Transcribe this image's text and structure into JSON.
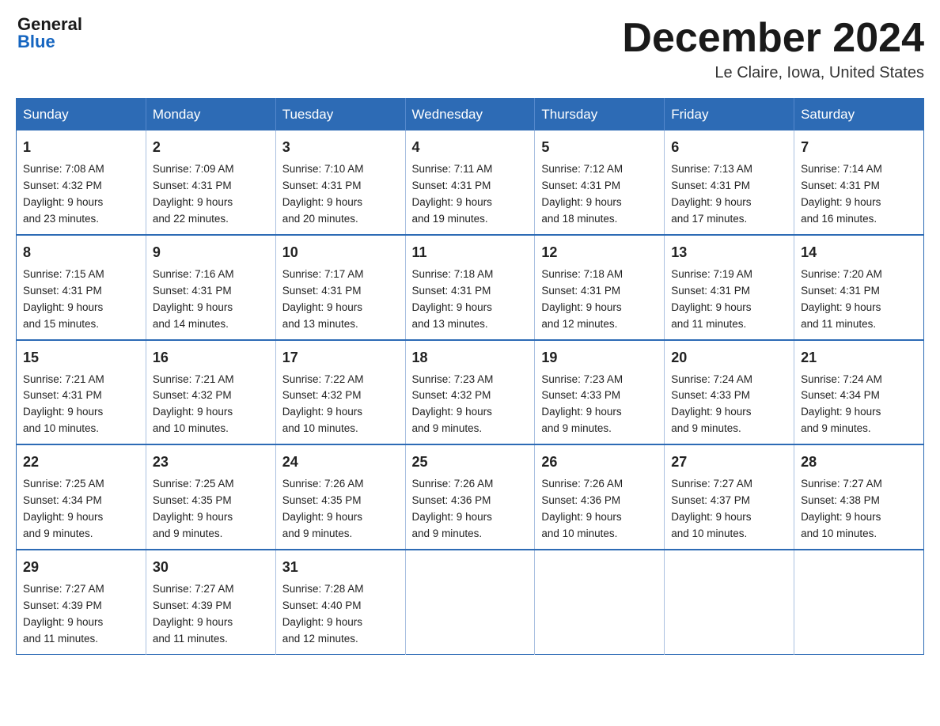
{
  "header": {
    "logo_general": "General",
    "logo_blue": "Blue",
    "month_title": "December 2024",
    "location": "Le Claire, Iowa, United States"
  },
  "days_of_week": [
    "Sunday",
    "Monday",
    "Tuesday",
    "Wednesday",
    "Thursday",
    "Friday",
    "Saturday"
  ],
  "weeks": [
    [
      {
        "num": "1",
        "sunrise": "7:08 AM",
        "sunset": "4:32 PM",
        "daylight": "9 hours and 23 minutes."
      },
      {
        "num": "2",
        "sunrise": "7:09 AM",
        "sunset": "4:31 PM",
        "daylight": "9 hours and 22 minutes."
      },
      {
        "num": "3",
        "sunrise": "7:10 AM",
        "sunset": "4:31 PM",
        "daylight": "9 hours and 20 minutes."
      },
      {
        "num": "4",
        "sunrise": "7:11 AM",
        "sunset": "4:31 PM",
        "daylight": "9 hours and 19 minutes."
      },
      {
        "num": "5",
        "sunrise": "7:12 AM",
        "sunset": "4:31 PM",
        "daylight": "9 hours and 18 minutes."
      },
      {
        "num": "6",
        "sunrise": "7:13 AM",
        "sunset": "4:31 PM",
        "daylight": "9 hours and 17 minutes."
      },
      {
        "num": "7",
        "sunrise": "7:14 AM",
        "sunset": "4:31 PM",
        "daylight": "9 hours and 16 minutes."
      }
    ],
    [
      {
        "num": "8",
        "sunrise": "7:15 AM",
        "sunset": "4:31 PM",
        "daylight": "9 hours and 15 minutes."
      },
      {
        "num": "9",
        "sunrise": "7:16 AM",
        "sunset": "4:31 PM",
        "daylight": "9 hours and 14 minutes."
      },
      {
        "num": "10",
        "sunrise": "7:17 AM",
        "sunset": "4:31 PM",
        "daylight": "9 hours and 13 minutes."
      },
      {
        "num": "11",
        "sunrise": "7:18 AM",
        "sunset": "4:31 PM",
        "daylight": "9 hours and 13 minutes."
      },
      {
        "num": "12",
        "sunrise": "7:18 AM",
        "sunset": "4:31 PM",
        "daylight": "9 hours and 12 minutes."
      },
      {
        "num": "13",
        "sunrise": "7:19 AM",
        "sunset": "4:31 PM",
        "daylight": "9 hours and 11 minutes."
      },
      {
        "num": "14",
        "sunrise": "7:20 AM",
        "sunset": "4:31 PM",
        "daylight": "9 hours and 11 minutes."
      }
    ],
    [
      {
        "num": "15",
        "sunrise": "7:21 AM",
        "sunset": "4:31 PM",
        "daylight": "9 hours and 10 minutes."
      },
      {
        "num": "16",
        "sunrise": "7:21 AM",
        "sunset": "4:32 PM",
        "daylight": "9 hours and 10 minutes."
      },
      {
        "num": "17",
        "sunrise": "7:22 AM",
        "sunset": "4:32 PM",
        "daylight": "9 hours and 10 minutes."
      },
      {
        "num": "18",
        "sunrise": "7:23 AM",
        "sunset": "4:32 PM",
        "daylight": "9 hours and 9 minutes."
      },
      {
        "num": "19",
        "sunrise": "7:23 AM",
        "sunset": "4:33 PM",
        "daylight": "9 hours and 9 minutes."
      },
      {
        "num": "20",
        "sunrise": "7:24 AM",
        "sunset": "4:33 PM",
        "daylight": "9 hours and 9 minutes."
      },
      {
        "num": "21",
        "sunrise": "7:24 AM",
        "sunset": "4:34 PM",
        "daylight": "9 hours and 9 minutes."
      }
    ],
    [
      {
        "num": "22",
        "sunrise": "7:25 AM",
        "sunset": "4:34 PM",
        "daylight": "9 hours and 9 minutes."
      },
      {
        "num": "23",
        "sunrise": "7:25 AM",
        "sunset": "4:35 PM",
        "daylight": "9 hours and 9 minutes."
      },
      {
        "num": "24",
        "sunrise": "7:26 AM",
        "sunset": "4:35 PM",
        "daylight": "9 hours and 9 minutes."
      },
      {
        "num": "25",
        "sunrise": "7:26 AM",
        "sunset": "4:36 PM",
        "daylight": "9 hours and 9 minutes."
      },
      {
        "num": "26",
        "sunrise": "7:26 AM",
        "sunset": "4:36 PM",
        "daylight": "9 hours and 10 minutes."
      },
      {
        "num": "27",
        "sunrise": "7:27 AM",
        "sunset": "4:37 PM",
        "daylight": "9 hours and 10 minutes."
      },
      {
        "num": "28",
        "sunrise": "7:27 AM",
        "sunset": "4:38 PM",
        "daylight": "9 hours and 10 minutes."
      }
    ],
    [
      {
        "num": "29",
        "sunrise": "7:27 AM",
        "sunset": "4:39 PM",
        "daylight": "9 hours and 11 minutes."
      },
      {
        "num": "30",
        "sunrise": "7:27 AM",
        "sunset": "4:39 PM",
        "daylight": "9 hours and 11 minutes."
      },
      {
        "num": "31",
        "sunrise": "7:28 AM",
        "sunset": "4:40 PM",
        "daylight": "9 hours and 12 minutes."
      },
      null,
      null,
      null,
      null
    ]
  ],
  "labels": {
    "sunrise": "Sunrise:",
    "sunset": "Sunset:",
    "daylight": "Daylight:"
  }
}
